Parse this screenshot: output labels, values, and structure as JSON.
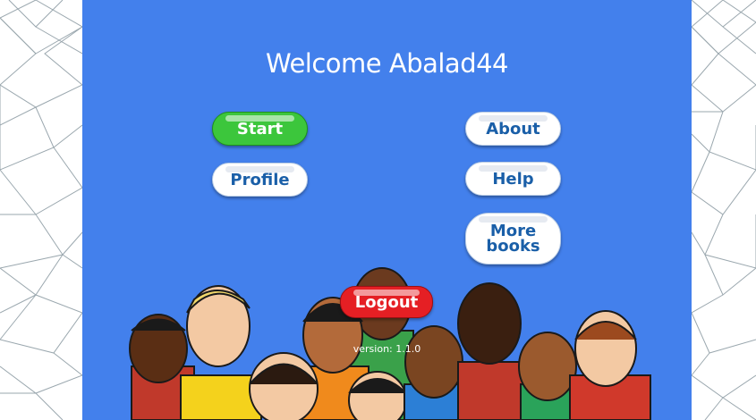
{
  "welcome": {
    "title": "Welcome Abalad44"
  },
  "buttons": {
    "start": "Start",
    "profile": "Profile",
    "about": "About",
    "help": "Help",
    "more_books_line1": "More",
    "more_books_line2": "books",
    "logout": "Logout"
  },
  "footer": {
    "version": "version: 1.1.0"
  },
  "colors": {
    "panel": "#4380ec",
    "start": "#3cc63c",
    "logout": "#e51f24",
    "button_text": "#1a5fa8",
    "pattern_lines": "#9aa7ae"
  },
  "illustration": {
    "icon": "children-group-illustration"
  }
}
